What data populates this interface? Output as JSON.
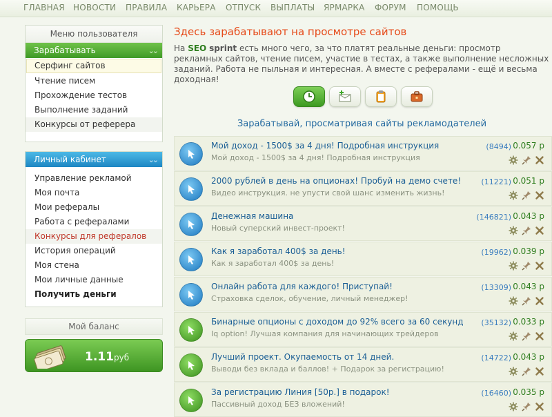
{
  "topnav": [
    "ГЛАВНАЯ",
    "НОВОСТИ",
    "ПРАВИЛА",
    "КАРЬЕРА",
    "ОТПУСК",
    "ВЫПЛАТЫ",
    "ЯРМАРКА",
    "ФОРУМ",
    "ПОМОЩЬ"
  ],
  "user_menu": {
    "header": "Меню пользователя",
    "earn_label": "Зарабатывать",
    "earn_items": [
      "Серфинг сайтов",
      "Чтение писем",
      "Прохождение тестов",
      "Выполнение заданий",
      "Конкурсы от реферера"
    ]
  },
  "cabinet": {
    "label": "Личный кабинет",
    "items": [
      "Управление рекламой",
      "Моя почта",
      "Мои рефералы",
      "Работа с рефералами",
      "Конкурсы для рефералов",
      "История операций",
      "Моя стена",
      "Мои личные данные",
      "Получить деньги"
    ]
  },
  "balance": {
    "header": "Мой баланс",
    "amount": "1.11",
    "currency": "руб"
  },
  "main": {
    "title": "Здесь зарабатывают на просмотре сайтов",
    "intro_prefix": "На ",
    "intro_brand_1": "SEO",
    "intro_brand_2": "sprint",
    "intro_text": " есть много чего, за что платят реальные деньги: просмотр рекламных сайтов, чтение писем, участие в тестах, а также выполнение несложных заданий. Работа не пыльная и интересная. А вместе с рефералами - ещё и весьма доходная!",
    "section_title": "Зарабатывай, просматривая сайты рекламодателей"
  },
  "tabs": [
    "clock-icon",
    "mail-plus-icon",
    "clipboard-icon",
    "briefcase-icon"
  ],
  "colors": {
    "accent_green": "#3f9a25",
    "accent_blue": "#1d86c3",
    "title_orange": "#e64a19"
  },
  "ads": [
    {
      "title": "Мой доход - 1500$ за 4 дня! Подробная инструкция",
      "desc": "Мой доход - 1500$ за 4 дня! Подробная инструкция",
      "views": "(8494)",
      "price": "0.057 р",
      "color": "blue"
    },
    {
      "title": "2000 рублей в день на опционах! Пробуй на демо счете!",
      "desc": "Видео инструкция. не упусти свой шанс изменить жизнь!",
      "views": "(11221)",
      "price": "0.051 р",
      "color": "blue"
    },
    {
      "title": "Денежная машина",
      "desc": "Новый суперский инвест-проект!",
      "views": "(146821)",
      "price": "0.043 р",
      "color": "blue"
    },
    {
      "title": "Как я заработал 400$ за день!",
      "desc": "Как я заработал 400$ за день!",
      "views": "(19962)",
      "price": "0.039 р",
      "color": "blue"
    },
    {
      "title": "Онлайн работа для каждого! Приступай!",
      "desc": "Страховка сделок, обучение, личный менеджер!",
      "views": "(13309)",
      "price": "0.043 р",
      "color": "blue"
    },
    {
      "title": "Бинарные опционы с доходом до 92% всего за 60 секунд",
      "desc": "Iq option! Лучшая компания для начинающих трейдеров",
      "views": "(35132)",
      "price": "0.033 р",
      "color": "green"
    },
    {
      "title": "Лучший проект. Окупаемость от 14 дней.",
      "desc": "Выводи без вклада и баллов! + Подарок за регистрацию!",
      "views": "(14722)",
      "price": "0.043 р",
      "color": "green"
    },
    {
      "title": "За регистрацию Линия [50р.] в подарок!",
      "desc": "Пассивный доход БЕЗ вложений!",
      "views": "(16460)",
      "price": "0.035 р",
      "color": "green"
    }
  ]
}
